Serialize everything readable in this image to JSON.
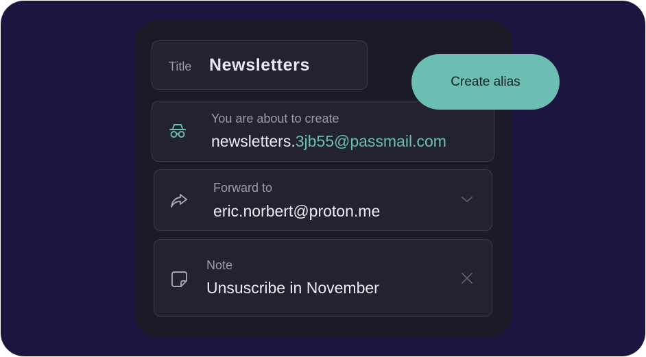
{
  "title_field": {
    "label": "Title",
    "value": "Newsletters"
  },
  "create_button": {
    "label": "Create alias"
  },
  "alias_field": {
    "caption": "You are about to create",
    "prefix": "newsletters.",
    "suffix": "3jb55@passmail.com",
    "icon": "incognito-icon"
  },
  "forward_field": {
    "caption": "Forward to",
    "value": "eric.norbert@proton.me",
    "icon": "forward-arrow-icon",
    "action_icon": "chevron-down-icon"
  },
  "note_field": {
    "caption": "Note",
    "value": "Unsuscribe in November",
    "icon": "note-icon",
    "action_icon": "close-icon"
  },
  "colors": {
    "background": "#1b1640",
    "panel": "#1b1b27",
    "field": "#222230",
    "accent": "#6cbdb2",
    "alias_suffix": "#6bc0b0"
  }
}
